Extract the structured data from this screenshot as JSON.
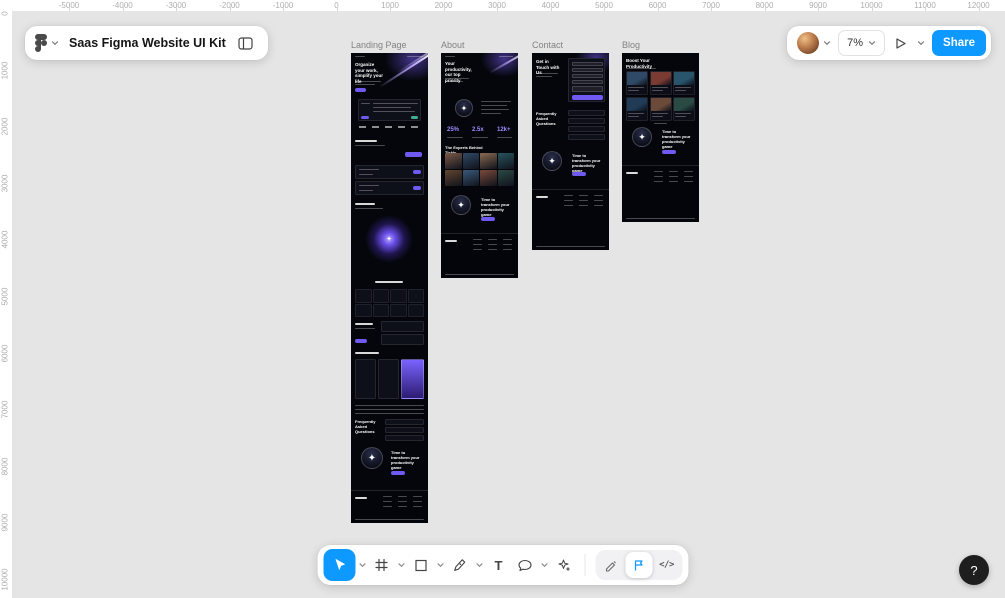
{
  "header": {
    "file_title": "Saas Figma Website UI Kit",
    "zoom_value": "7%",
    "share_label": "Share",
    "help_label": "?"
  },
  "colors": {
    "accent_purple": "#6e5af0",
    "figma_blue": "#0d99ff",
    "canvas_gray": "#e5e5e5"
  },
  "rulers": {
    "top": [
      "-5000",
      "-4000",
      "-3000",
      "-2000",
      "-1000",
      "0",
      "1000",
      "2000",
      "3000",
      "4000",
      "5000",
      "6000",
      "7000",
      "8000",
      "9000",
      "10000",
      "11000",
      "12000"
    ],
    "left": [
      "0",
      "1000",
      "2000",
      "3000",
      "4000",
      "5000",
      "6000",
      "7000",
      "8000",
      "9000",
      "10000"
    ]
  },
  "tools": {
    "text_glyph": "T",
    "code_glyph": "</>"
  },
  "frames": [
    {
      "label": "Landing Page",
      "hero_title": "Organize your work, simplify your life",
      "faq_title": "Frequently Asked Questions",
      "cta_title": "Time to transform your productivity game"
    },
    {
      "label": "About",
      "hero_title": "Your productivity, our top priority",
      "stats": [
        "25%",
        "2.5x",
        "12k+"
      ],
      "team_title": "The Experts Behind Tickly",
      "cta_title": "Time to transform your productivity game"
    },
    {
      "label": "Contact",
      "hero_title": "Get in Touch with Us",
      "faq_title": "Frequently Asked Questions",
      "cta_title": "Time to transform your productivity game"
    },
    {
      "label": "Blog",
      "hero_title": "Boost Your Productivity",
      "cta_title": "Time to transform your productivity game"
    }
  ]
}
